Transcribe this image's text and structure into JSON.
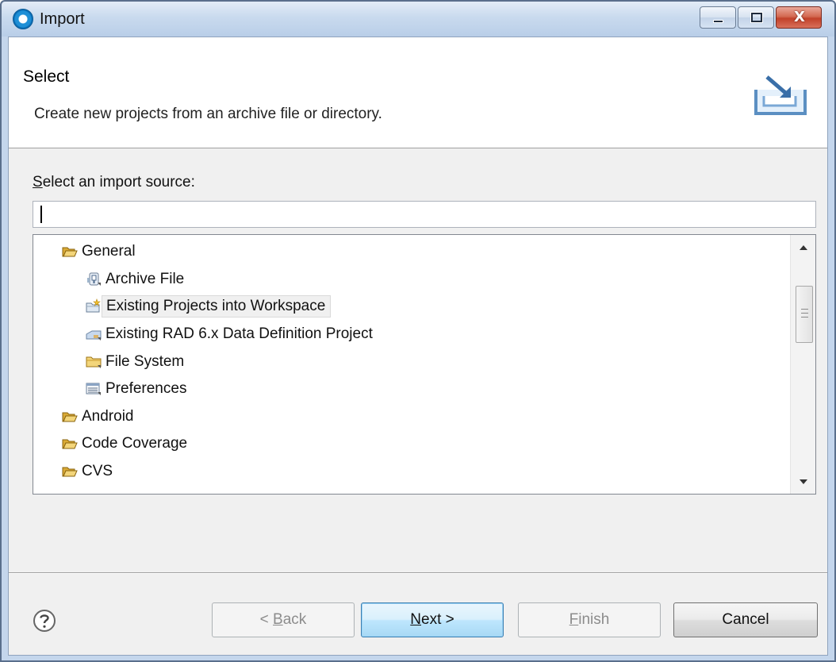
{
  "window": {
    "title": "Import",
    "controls": {
      "minimize": "minimize",
      "maximize": "maximize",
      "close": "X"
    }
  },
  "header": {
    "title": "Select",
    "description": "Create new projects from an archive file or directory."
  },
  "source": {
    "label_first": "S",
    "label_rest": "elect an import source:",
    "filter_value": "",
    "filter_placeholder": ""
  },
  "tree": {
    "items": [
      {
        "label": "General",
        "icon": "open-folder-icon",
        "level": 0
      },
      {
        "label": "Archive File",
        "icon": "archive-file-icon",
        "level": 1
      },
      {
        "label": "Existing Projects into Workspace",
        "icon": "existing-projects-icon",
        "level": 1,
        "selected": true
      },
      {
        "label": "Existing RAD 6.x Data Definition Project",
        "icon": "data-definition-icon",
        "level": 1
      },
      {
        "label": "File System",
        "icon": "folder-icon",
        "level": 1
      },
      {
        "label": "Preferences",
        "icon": "preferences-icon",
        "level": 1
      },
      {
        "label": "Android",
        "icon": "open-folder-icon",
        "level": 0
      },
      {
        "label": "Code Coverage",
        "icon": "open-folder-icon",
        "level": 0
      },
      {
        "label": "CVS",
        "icon": "open-folder-icon",
        "level": 0
      }
    ]
  },
  "buttons": {
    "back_prefix": "< ",
    "back_mnemonic": "B",
    "back_rest": "ack",
    "next_mnemonic": "N",
    "next_rest": "ext >",
    "finish_mnemonic": "F",
    "finish_rest": "inish",
    "cancel": "Cancel"
  },
  "colors": {
    "accent": "#3c7fb1",
    "folder": "#e8c25a",
    "close": "#c1412a"
  }
}
